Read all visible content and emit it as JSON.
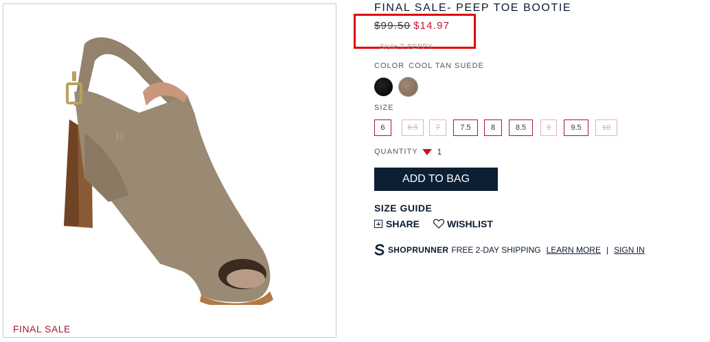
{
  "product": {
    "title": "FINAL SALE- PEEP TOE BOOTIE",
    "old_price": "$99.50",
    "new_price": "$14.97",
    "style": "Style T-PEPPY",
    "final_sale_tag": "FINAL SALE"
  },
  "color": {
    "label": "COLOR",
    "value": "COOL TAN SUEDE",
    "swatches": [
      {
        "name": "black",
        "hex": "#000000"
      },
      {
        "name": "cool tan suede",
        "hex": "#8c7663"
      }
    ]
  },
  "size": {
    "label": "SIZE",
    "options": [
      {
        "label": "6",
        "available": true
      },
      {
        "label": "6.5",
        "available": false
      },
      {
        "label": "7",
        "available": false
      },
      {
        "label": "7.5",
        "available": true
      },
      {
        "label": "8",
        "available": true
      },
      {
        "label": "8.5",
        "available": true
      },
      {
        "label": "9",
        "available": false
      },
      {
        "label": "9.5",
        "available": true
      },
      {
        "label": "10",
        "available": false
      }
    ]
  },
  "quantity": {
    "label": "QUANTITY",
    "value": "1"
  },
  "actions": {
    "add_to_bag": "ADD TO BAG",
    "size_guide": "SIZE GUIDE",
    "share": "SHARE",
    "wishlist": "WISHLIST"
  },
  "shoprunner": {
    "brand": "SHOPRUNNER",
    "shipping": "FREE 2-DAY SHIPPING",
    "learn_more": "LEARN MORE",
    "separator": "|",
    "sign_in": "SIGN IN"
  },
  "colors": {
    "navy": "#0c1f33",
    "sale_red": "#c8102e",
    "highlight_red": "#e00000"
  }
}
